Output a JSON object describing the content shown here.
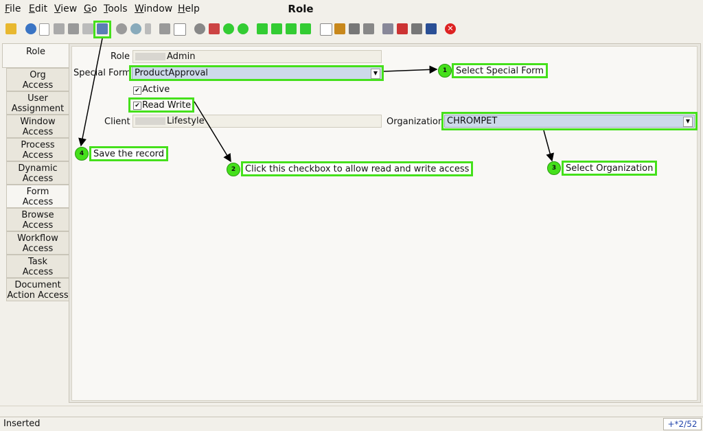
{
  "menu": {
    "items": [
      {
        "label": "File",
        "key": "file"
      },
      {
        "label": "Edit",
        "key": "edit"
      },
      {
        "label": "View",
        "key": "view"
      },
      {
        "label": "Go",
        "key": "go"
      },
      {
        "label": "Tools",
        "key": "tools"
      },
      {
        "label": "Window",
        "key": "window"
      },
      {
        "label": "Help",
        "key": "help"
      }
    ]
  },
  "window": {
    "title": "Role"
  },
  "toolbar": {
    "icons": [
      "undo-icon",
      "help-icon",
      "new-icon",
      "copy-icon",
      "delete-icon",
      "delete-selection-icon",
      "save-icon",
      "refresh-icon",
      "find-icon",
      "attachment-icon",
      "chat-icon",
      "grid-toggle-icon",
      "history-icon",
      "home-icon",
      "back-icon",
      "forward-icon",
      "first-record-icon",
      "previous-record-icon",
      "next-record-icon",
      "last-record-icon",
      "report-icon",
      "archive-icon",
      "print-preview-icon",
      "print-icon",
      "zoom-across-icon",
      "active-workflows-icon",
      "requests-icon",
      "product-info-icon",
      "exit-icon"
    ]
  },
  "tabs": [
    {
      "label": "Role"
    },
    {
      "label": "Org\nAccess"
    },
    {
      "label": "User\nAssignment"
    },
    {
      "label": "Window\nAccess"
    },
    {
      "label": "Process\nAccess"
    },
    {
      "label": "Dynamic\nAccess"
    },
    {
      "label": "Form\nAccess"
    },
    {
      "label": "Browse\nAccess"
    },
    {
      "label": "Workflow\nAccess"
    },
    {
      "label": "Task\nAccess"
    },
    {
      "label": "Document\nAction Access"
    }
  ],
  "form": {
    "role_label": "Role",
    "role_value": "Admin",
    "special_form_label": "Special Form",
    "special_form_value": "ProductApproval",
    "active_label": "Active",
    "active_checked": true,
    "read_write_label": "Read Write",
    "read_write_checked": true,
    "client_label": "Client",
    "client_value": "Lifestyle",
    "organization_label": "Organization",
    "organization_value": "CHROMPET"
  },
  "annotations": [
    {
      "number": "1",
      "text": "Select Special Form"
    },
    {
      "number": "2",
      "text": "Click this checkbox to allow read and write access"
    },
    {
      "number": "3",
      "text": "Select Organization"
    },
    {
      "number": "4",
      "text": "Save the record"
    }
  ],
  "status": {
    "text": "Inserted",
    "record_count": "+*2/52"
  },
  "colors": {
    "highlight": "#45e01b",
    "select_bg": "#cdd9ea"
  }
}
